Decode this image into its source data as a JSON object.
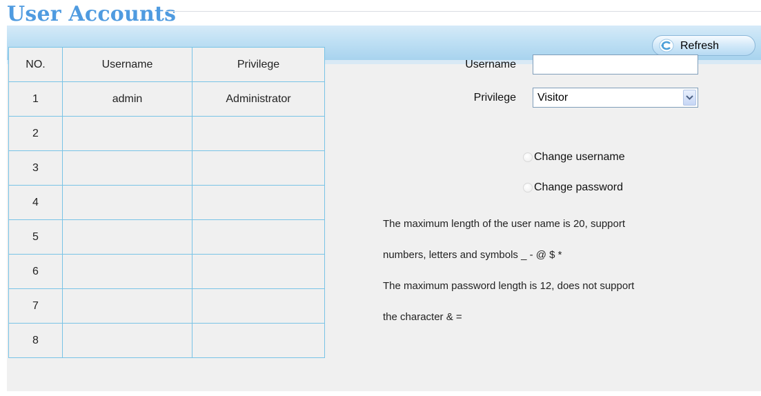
{
  "title": "User Accounts",
  "toolbar": {
    "refresh_label": "Refresh",
    "refresh_icon": "refresh-arrow-icon"
  },
  "table": {
    "headers": [
      "NO.",
      "Username",
      "Privilege"
    ],
    "rows": [
      {
        "no": "1",
        "username": "admin",
        "privilege": "Administrator"
      },
      {
        "no": "2",
        "username": "",
        "privilege": ""
      },
      {
        "no": "3",
        "username": "",
        "privilege": ""
      },
      {
        "no": "4",
        "username": "",
        "privilege": ""
      },
      {
        "no": "5",
        "username": "",
        "privilege": ""
      },
      {
        "no": "6",
        "username": "",
        "privilege": ""
      },
      {
        "no": "7",
        "username": "",
        "privilege": ""
      },
      {
        "no": "8",
        "username": "",
        "privilege": ""
      }
    ]
  },
  "form": {
    "username_label": "Username",
    "username_value": "",
    "privilege_label": "Privilege",
    "privilege_value": "Visitor",
    "change_username_label": "Change username",
    "change_password_label": "Change password"
  },
  "notes": {
    "line1": "The maximum length of the user name is 20, support",
    "line2": "numbers, letters and symbols _ - @ $ *",
    "line3": "The maximum password length is 12, does not support",
    "line4": "the character & ="
  },
  "colors": {
    "title": "#4f9be0",
    "table_border": "#78c3e6",
    "panel_bg": "#f0f0f0",
    "toolbar_bg": "#bfe0f4"
  }
}
